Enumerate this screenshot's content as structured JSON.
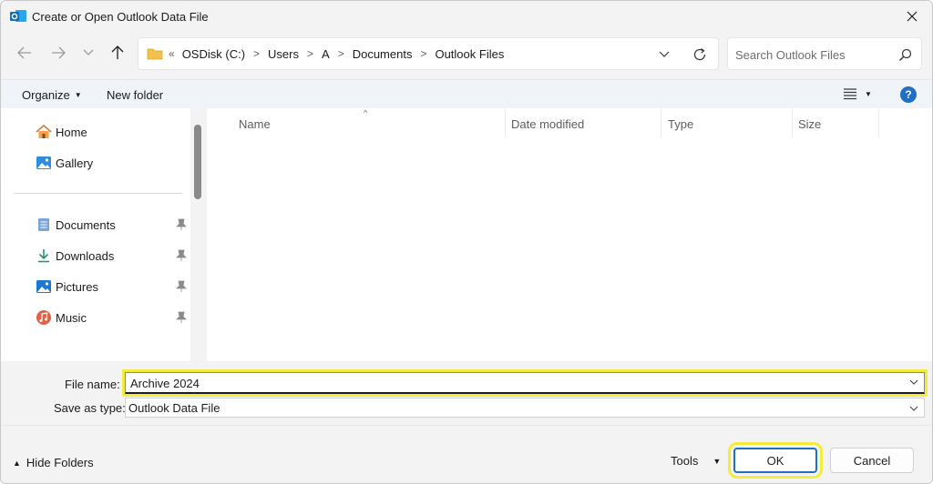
{
  "window": {
    "title": "Create or Open Outlook Data File",
    "app_icon": "outlook-icon",
    "close_icon": "close-icon"
  },
  "nav": {
    "back_icon": "arrow-left-icon",
    "forward_icon": "arrow-right-icon",
    "recent_icon": "chevron-down-icon",
    "up_icon": "arrow-up-icon",
    "address": {
      "overflow": "«",
      "crumbs": [
        "OSDisk (C:)",
        "Users",
        "A",
        "Documents",
        "Outlook Files"
      ],
      "separator": ">"
    },
    "refresh_icon": "refresh-icon",
    "search": {
      "placeholder": "Search Outlook Files",
      "value": ""
    }
  },
  "toolbar": {
    "organize_label": "Organize",
    "new_folder_label": "New folder",
    "view_icon": "list-view-icon",
    "help_label": "?"
  },
  "sidebar": {
    "items": [
      {
        "label": "Home",
        "icon": "home-icon",
        "pinned": false
      },
      {
        "label": "Gallery",
        "icon": "gallery-icon",
        "pinned": false
      },
      {
        "label": "Documents",
        "icon": "documents-icon",
        "pinned": true
      },
      {
        "label": "Downloads",
        "icon": "download-icon",
        "pinned": true
      },
      {
        "label": "Pictures",
        "icon": "pictures-icon",
        "pinned": true
      },
      {
        "label": "Music",
        "icon": "music-icon",
        "pinned": true
      }
    ]
  },
  "file_list": {
    "columns": [
      "Name",
      "Date modified",
      "Type",
      "Size"
    ],
    "sort_indicator": "^",
    "rows": []
  },
  "fields": {
    "file_name_label": "File name:",
    "file_name_value": "Archive 2024",
    "save_type_label": "Save as type:",
    "save_type_value": "Outlook Data File"
  },
  "footer": {
    "hide_folders_label": "Hide Folders",
    "tools_label": "Tools",
    "ok_label": "OK",
    "cancel_label": "Cancel"
  },
  "colors": {
    "accent": "#1f6fc5",
    "highlight": "#f4ec3c",
    "folder": "#f2c14e"
  }
}
